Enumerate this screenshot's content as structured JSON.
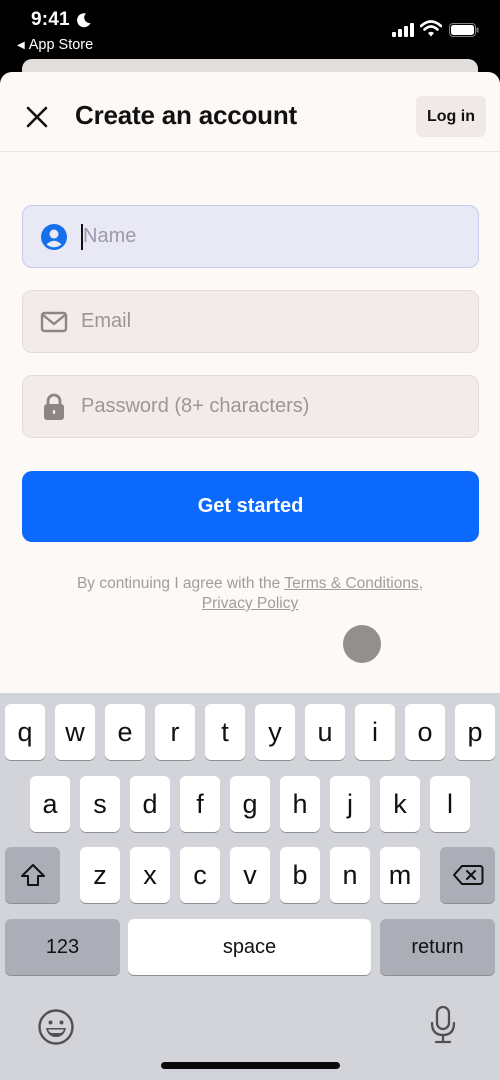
{
  "status_bar": {
    "time": "9:41",
    "back_app": "App Store",
    "icons": [
      "moon-icon",
      "cellular-signal-icon",
      "wifi-icon",
      "battery-icon"
    ]
  },
  "header": {
    "close_icon": "close-icon",
    "title": "Create an account",
    "login_label": "Log in"
  },
  "form": {
    "name": {
      "placeholder": "Name",
      "value": "",
      "icon": "person-circle-icon",
      "focused": true
    },
    "email": {
      "placeholder": "Email",
      "value": "",
      "icon": "envelope-icon"
    },
    "password": {
      "placeholder": "Password (8+ characters)",
      "value": "",
      "icon": "lock-icon"
    },
    "submit_label": "Get started"
  },
  "legal": {
    "prefix": "By continuing I agree with the ",
    "terms_link": "Terms & Conditions",
    "separator": ",",
    "privacy_link": "Privacy Policy"
  },
  "colors": {
    "accent": "#0b69fd",
    "sheet_background": "#fdf9f7",
    "field_background": "#f2ebe9",
    "focused_field_background": "#e9e8f5",
    "keyboard_background": "#d3d4d9"
  },
  "keyboard": {
    "row1": [
      "q",
      "w",
      "e",
      "r",
      "t",
      "y",
      "u",
      "i",
      "o",
      "p"
    ],
    "row2": [
      "a",
      "s",
      "d",
      "f",
      "g",
      "h",
      "j",
      "k",
      "l"
    ],
    "row3": [
      "z",
      "x",
      "c",
      "v",
      "b",
      "n",
      "m"
    ],
    "numbers_label": "123",
    "space_label": "space",
    "return_label": "return",
    "icons": [
      "shift-icon",
      "delete-icon",
      "emoji-icon",
      "microphone-icon"
    ]
  }
}
